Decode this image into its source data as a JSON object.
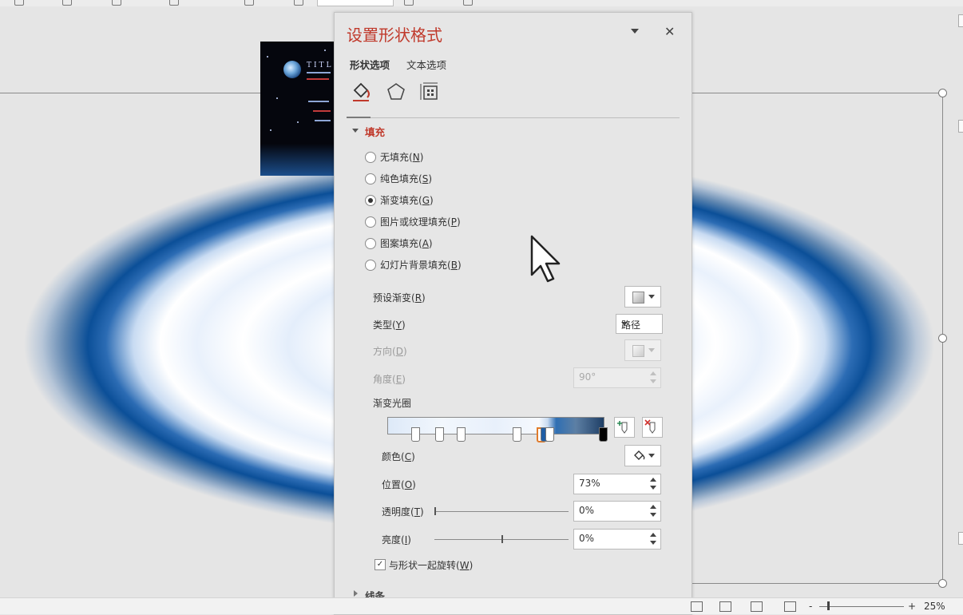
{
  "panel": {
    "title": "设置形状格式",
    "close_glyph": "✕",
    "tabs": [
      {
        "label": "形状选项",
        "active": true
      },
      {
        "label": "文本选项",
        "active": false
      }
    ],
    "icon_tabs": [
      "fill-line-icon",
      "effects-icon",
      "size-properties-icon"
    ]
  },
  "fill": {
    "section_title": "填充",
    "options": [
      {
        "label": "无填充",
        "key": "N",
        "checked": false
      },
      {
        "label": "纯色填充",
        "key": "S",
        "checked": false
      },
      {
        "label": "渐变填充",
        "key": "G",
        "checked": true
      },
      {
        "label": "图片或纹理填充",
        "key": "P",
        "checked": false
      },
      {
        "label": "图案填充",
        "key": "A",
        "checked": false
      },
      {
        "label": "幻灯片背景填充",
        "key": "B",
        "checked": false
      }
    ],
    "preset": {
      "label": "预设渐变",
      "key": "R"
    },
    "type": {
      "label": "类型",
      "key": "Y",
      "value": "路径"
    },
    "direction": {
      "label": "方向",
      "key": "D"
    },
    "angle": {
      "label": "角度",
      "key": "E",
      "value": "90°"
    },
    "stops_label": "渐变光圈",
    "stop_positions": [
      13,
      24,
      34,
      60,
      71,
      73,
      75,
      100
    ],
    "color": {
      "label": "颜色",
      "key": "C"
    },
    "position": {
      "label": "位置",
      "key": "O",
      "value": "73%"
    },
    "transparency": {
      "label": "透明度",
      "key": "T",
      "value": "0%",
      "level": 0
    },
    "brightness": {
      "label": "亮度",
      "key": "I",
      "value": "0%",
      "level": 0.5
    },
    "rotate": {
      "label": "与形状一起旋转",
      "key": "W",
      "checked": true
    }
  },
  "line": {
    "section_title": "线条"
  },
  "thumbnail": {
    "title": "TITLE"
  },
  "status_bar": {
    "zoom": "25%",
    "minus": "-",
    "plus": "+"
  },
  "colors": {
    "accent": "#c0392b",
    "gradient_blue": "#0b4f98",
    "selected_stop": "#e07b2c"
  }
}
